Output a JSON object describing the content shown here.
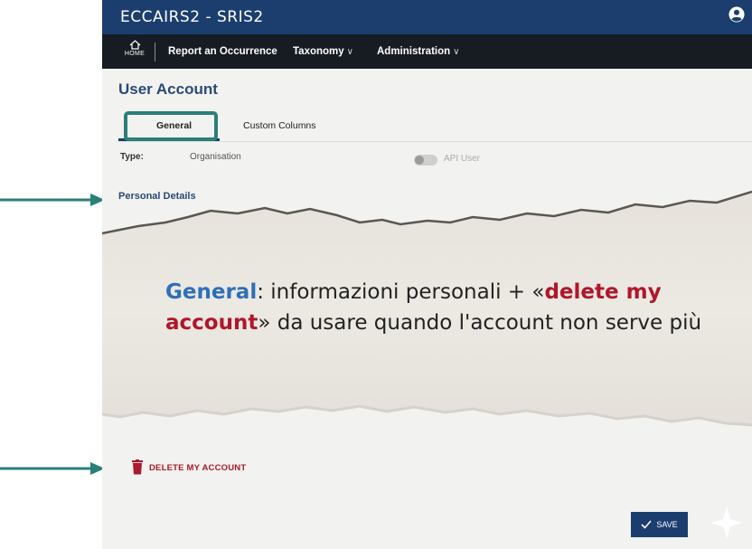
{
  "app": {
    "title": "ECCAIRS2 - SRIS2"
  },
  "nav": {
    "home_label": "HOME",
    "items": [
      {
        "label": "Report an Occurrence"
      },
      {
        "label": "Taxonomy",
        "chevron": "∨"
      },
      {
        "label": "Administration",
        "chevron": "∨"
      }
    ]
  },
  "page": {
    "title": "User Account"
  },
  "tabs": [
    {
      "label": "General",
      "active": true
    },
    {
      "label": "Custom Columns",
      "active": false
    }
  ],
  "form": {
    "type_label": "Type:",
    "type_value": "Organisation",
    "api_user_label": "API User",
    "api_user_enabled": false,
    "section_title": "Personal Details"
  },
  "callout": {
    "part1_bold": "General",
    "part2": ": informazioni personali + «",
    "part3_bold": "delete my account",
    "part4": "» da usare quando l'account non serve più"
  },
  "actions": {
    "delete_label": "DELETE MY ACCOUNT",
    "save_label": "SAVE"
  },
  "colors": {
    "topbar": "#1b3e6e",
    "navbar": "#171c22",
    "arrow": "#2a7f77",
    "danger": "#a8192e",
    "callout_blue": "#2e6fb8"
  },
  "icons": [
    "user-circle-icon",
    "home-icon",
    "trash-icon",
    "check-icon",
    "arrow-right-icon"
  ]
}
